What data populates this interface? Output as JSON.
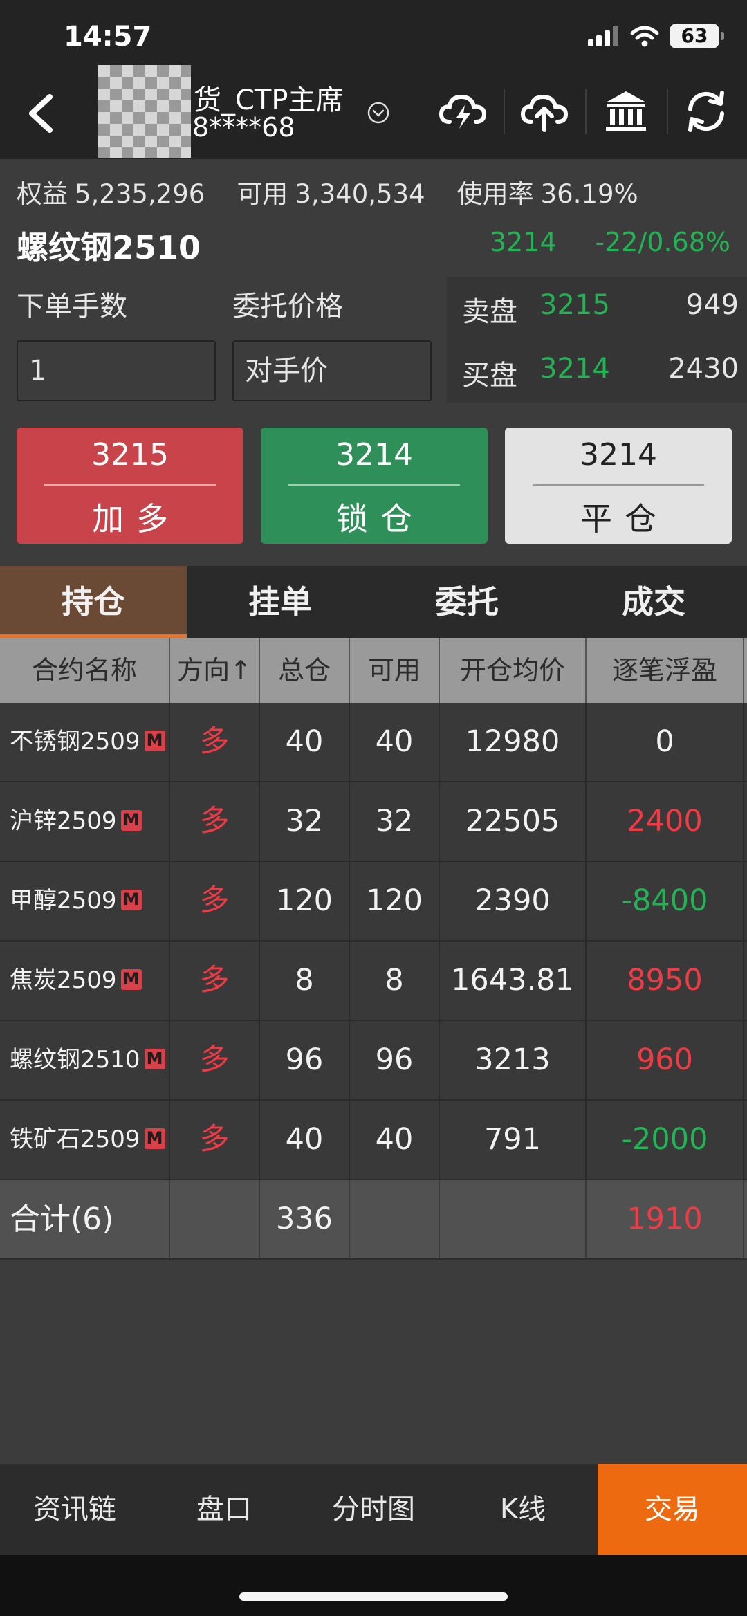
{
  "status": {
    "time": "14:57",
    "battery": "63"
  },
  "header": {
    "account_name": "货_CTP主席",
    "account_number": "8****68",
    "icons": [
      "back-arrow-icon",
      "cloud-lightning-icon",
      "cloud-upload-icon",
      "bank-icon",
      "refresh-icon"
    ]
  },
  "summary": {
    "equity_label": "权益",
    "equity": "5,235,296",
    "available_label": "可用",
    "available": "3,340,534",
    "usage_label": "使用率",
    "usage": "36.19%"
  },
  "contract": {
    "name": "螺纹钢2510",
    "price": "3214",
    "change": "-22/0.68%"
  },
  "order": {
    "qty_label": "下单手数",
    "qty_value": "1",
    "price_label": "委托价格",
    "price_value": "对手价"
  },
  "book": {
    "ask_label": "卖盘",
    "ask_price": "3215",
    "ask_volume": "949",
    "bid_label": "买盘",
    "bid_price": "3214",
    "bid_volume": "2430"
  },
  "actions": [
    {
      "price": "3215",
      "label": "加多"
    },
    {
      "price": "3214",
      "label": "锁仓"
    },
    {
      "price": "3214",
      "label": "平仓"
    }
  ],
  "tabs": [
    "持仓",
    "挂单",
    "委托",
    "成交"
  ],
  "table": {
    "headers": [
      "合约名称",
      "方向↑",
      "总仓",
      "可用",
      "开仓均价",
      "逐笔浮盈"
    ],
    "rows": [
      {
        "name": "不锈钢2509",
        "dir": "多",
        "total": "40",
        "avail": "40",
        "avg": "12980",
        "pnl": "0"
      },
      {
        "name": "沪锌2509",
        "dir": "多",
        "total": "32",
        "avail": "32",
        "avg": "22505",
        "pnl": "2400"
      },
      {
        "name": "甲醇2509",
        "dir": "多",
        "total": "120",
        "avail": "120",
        "avg": "2390",
        "pnl": "-8400"
      },
      {
        "name": "焦炭2509",
        "dir": "多",
        "total": "8",
        "avail": "8",
        "avg": "1643.81",
        "pnl": "8950"
      },
      {
        "name": "螺纹钢2510",
        "dir": "多",
        "total": "96",
        "avail": "96",
        "avg": "3213",
        "pnl": "960"
      },
      {
        "name": "铁矿石2509",
        "dir": "多",
        "total": "40",
        "avail": "40",
        "avg": "791",
        "pnl": "-2000"
      }
    ],
    "badge": "M",
    "total": {
      "label": "合计(6)",
      "total": "336",
      "pnl": "1910"
    }
  },
  "bottom_nav": [
    "资讯链",
    "盘口",
    "分时图",
    "K线",
    "交易"
  ],
  "colors": {
    "up": "#ee3b45",
    "down": "#22b454",
    "accent": "#ee6a10"
  }
}
